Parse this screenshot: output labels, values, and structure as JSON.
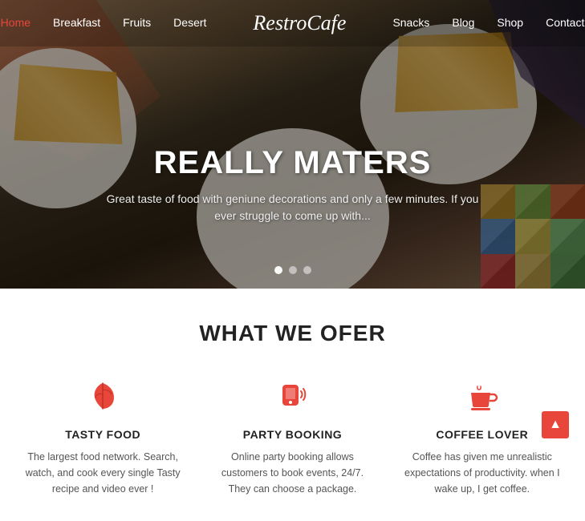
{
  "brand": "RestroCafe",
  "nav": {
    "links": [
      {
        "label": "Home",
        "active": true
      },
      {
        "label": "Breakfast",
        "active": false
      },
      {
        "label": "Fruits",
        "active": false
      },
      {
        "label": "Desert",
        "active": false
      },
      {
        "label": "Snacks",
        "active": false
      },
      {
        "label": "Blog",
        "active": false
      },
      {
        "label": "Shop",
        "active": false
      },
      {
        "label": "Contact",
        "active": false
      }
    ]
  },
  "hero": {
    "title": "REALLY MATERS",
    "subtitle": "Great taste of food with geniune decorations and only a few minutes. If you ever struggle to come up with...",
    "dots": [
      {
        "active": true
      },
      {
        "active": false
      },
      {
        "active": false
      }
    ]
  },
  "offers": {
    "section_title": "WHAT WE OFER",
    "items": [
      {
        "icon": "leaf",
        "name": "TASTY FOOD",
        "desc": "The largest food network. Search, watch, and cook every single Tasty recipe and video ever !"
      },
      {
        "icon": "phone-wave",
        "name": "PARTY BOOKING",
        "desc": "Online party booking allows customers to book events, 24/7. They can choose a package."
      },
      {
        "icon": "coffee",
        "name": "COFFEE LOVER",
        "desc": "Coffee has given me unrealistic expectations of productivity. when I wake up, I get coffee."
      }
    ]
  },
  "back_to_top_label": "▲",
  "colors": {
    "accent": "#e8463a",
    "nav_bg": "rgba(0,0,0,0.18)",
    "hero_dark": "rgba(0,0,0,0.38)"
  },
  "geo_tiles": [
    {
      "color": "#d4a843"
    },
    {
      "color": "#8fbc5a"
    },
    {
      "color": "#c8623a"
    },
    {
      "color": "#5a8fc8"
    },
    {
      "color": "#e0d060"
    },
    {
      "color": "#7abf7a"
    },
    {
      "color": "#c84848"
    },
    {
      "color": "#d4b860"
    },
    {
      "color": "#5a9a5a"
    }
  ]
}
